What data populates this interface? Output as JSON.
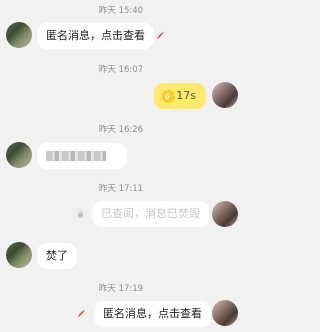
{
  "messages": {
    "t1": "昨天 15:40",
    "m1": "匿名消息，点击查看",
    "t2": "昨天 16:07",
    "m2_voice": "17s",
    "t3": "昨天 16:26",
    "t4": "昨天 17:11",
    "m4": "已查阅，消息已焚毁",
    "m5": "焚了",
    "t5": "昨天 17:19",
    "m6": "匿名消息，点击查看"
  },
  "colors": {
    "background": "#f1f1f1",
    "bubble": "#ffffff",
    "voice_bubble": "#ffe96b",
    "timestamp": "#8e8e8e",
    "burn_flame": "#e0464a"
  },
  "icons": {
    "flame": "flame-icon",
    "voice": "voice-wave-icon",
    "burned": "fire-burned-icon"
  }
}
